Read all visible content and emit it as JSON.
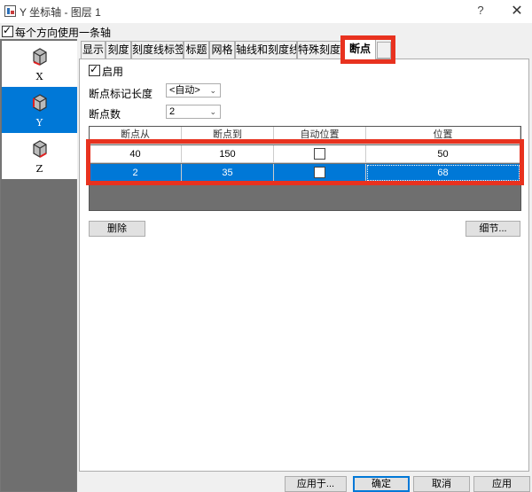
{
  "window": {
    "title": "Y 坐标轴 - 图层 1",
    "help": "?",
    "close": "✕"
  },
  "one_axis": {
    "label": "每个方向使用一条轴",
    "checked": true
  },
  "axes": [
    {
      "label": "X",
      "selected": false
    },
    {
      "label": "Y",
      "selected": true
    },
    {
      "label": "Z",
      "selected": false
    }
  ],
  "tabs": [
    "显示",
    "刻度",
    "刻度线标签",
    "标题",
    "网格",
    "轴线和刻度线",
    "特殊刻度线",
    "断点"
  ],
  "active_tab": "断点",
  "breaks": {
    "enable_label": "启用",
    "enabled": true,
    "mark_length_label": "断点标记长度",
    "mark_length_value": "<自动>",
    "count_label": "断点数",
    "count_value": "2",
    "columns": [
      "断点从",
      "断点到",
      "自动位置",
      "位置"
    ],
    "rows": [
      {
        "from": "40",
        "to": "150",
        "auto_pos": false,
        "pos": "50"
      },
      {
        "from": "2",
        "to": "35",
        "auto_pos": false,
        "pos": "68"
      }
    ],
    "delete_button": "删除",
    "details_button": "细节..."
  },
  "footer": {
    "apply_to": "应用于...",
    "ok": "确定",
    "cancel": "取消",
    "apply": "应用"
  },
  "colors": {
    "accent": "#0078d7",
    "highlight": "#e8321f"
  }
}
